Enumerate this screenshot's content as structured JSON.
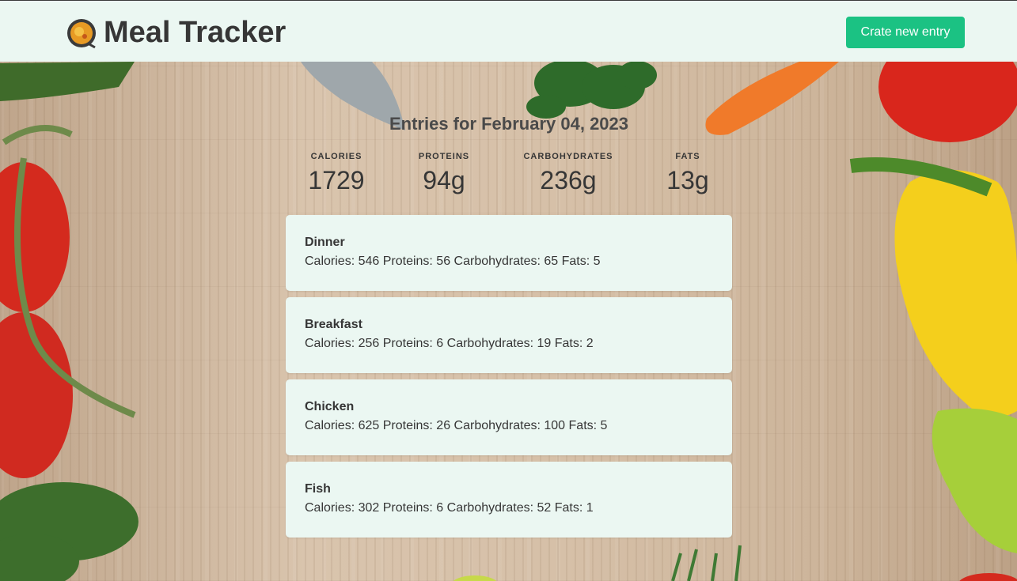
{
  "navbar": {
    "brand_icon": "cooking-pan-icon",
    "title": "Meal Tracker",
    "create_button_label": "Crate new entry"
  },
  "summary": {
    "title": "Entries for February 04, 2023",
    "stats": [
      {
        "label": "CALORIES",
        "value": "1729"
      },
      {
        "label": "PROTEINS",
        "value": "94g"
      },
      {
        "label": "CARBOHYDRATES",
        "value": "236g"
      },
      {
        "label": "FATS",
        "value": "13g"
      }
    ]
  },
  "entries": [
    {
      "name": "Dinner",
      "macros": "Calories: 546 Proteins: 56 Carbohydrates: 65 Fats: 5"
    },
    {
      "name": "Breakfast",
      "macros": "Calories: 256 Proteins: 6 Carbohydrates: 19 Fats: 2"
    },
    {
      "name": "Chicken",
      "macros": "Calories: 625 Proteins: 26 Carbohydrates: 100 Fats: 5"
    },
    {
      "name": "Fish",
      "macros": "Calories: 302 Proteins: 6 Carbohydrates: 52 Fats: 1"
    }
  ],
  "colors": {
    "navbar_bg": "#ebf7f2",
    "button_bg": "#1bc283",
    "card_bg": "#ebf7f2",
    "text": "#363636"
  }
}
